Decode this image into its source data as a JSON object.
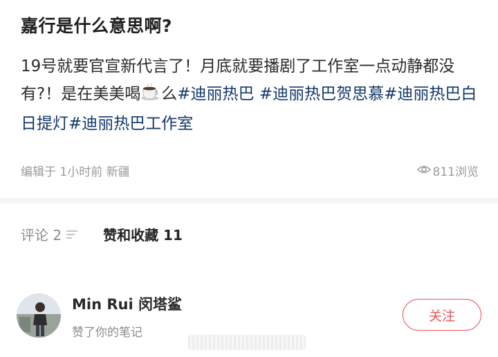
{
  "post": {
    "title": "嘉行是什么意思啊?",
    "text_part1": "19号就要官宣新代言了！月底就要播剧了工作室一点动静都没有?！是在美美喝",
    "text_part2": "么",
    "tags": [
      "#迪丽热巴",
      "#迪丽热巴贺思慕",
      "#迪丽热巴白日提灯",
      "#迪丽热巴工作室"
    ],
    "meta": "编辑于 1小时前 新疆",
    "views": "811浏览"
  },
  "tabs": {
    "comments": "评论 2",
    "likes_favorites": "赞和收藏 11"
  },
  "user": {
    "name": "Min Rui 闵塔鲨",
    "action": "赞了你的笔记",
    "follow_label": "关注"
  },
  "colors": {
    "tag": "#13386b",
    "accent": "#e4535b",
    "muted": "#9a9a9a"
  },
  "icons": [
    "coffee-icon",
    "eye-icon",
    "sort-icon"
  ]
}
